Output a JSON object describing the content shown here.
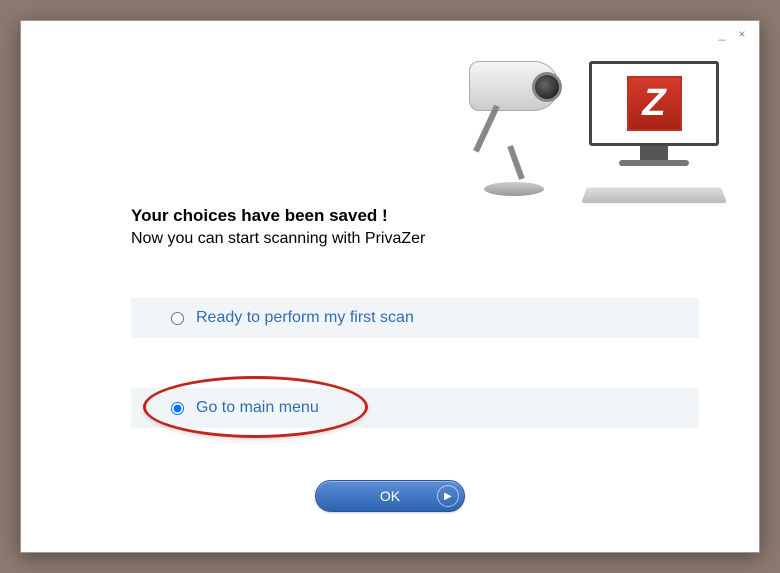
{
  "titlebar": {
    "minimize_glyph": "_",
    "close_glyph": "×"
  },
  "header": {
    "title": "Your choices have been saved !",
    "subtitle": "Now you can start scanning with PrivaZer"
  },
  "options": [
    {
      "label": "Ready to perform my first scan",
      "selected": false
    },
    {
      "label": "Go to main menu",
      "selected": true,
      "highlighted": true
    }
  ],
  "buttons": {
    "ok": "OK"
  },
  "logo_letter": "Z"
}
